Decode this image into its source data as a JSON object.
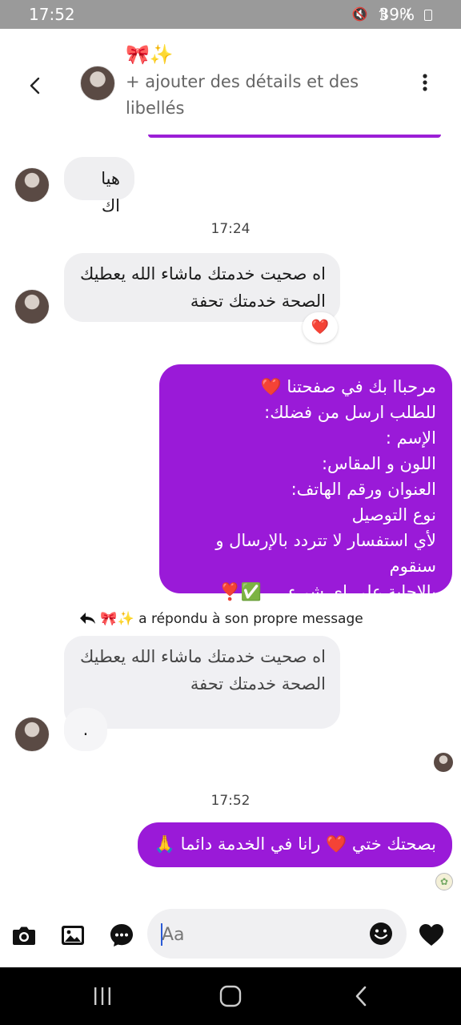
{
  "status_bar": {
    "time": "17:52",
    "battery": "39%"
  },
  "header": {
    "title_emoji": "🎀✨",
    "subtitle": "+ ajouter des détails et des libellés"
  },
  "messages": {
    "m1": "هيا اك",
    "ts1": "17:24",
    "m2": "اه صحيت خدمتك ماشاء الله يعطيك الصحة خدمتك تحفة",
    "m2_reaction": "❤️",
    "m3": [
      "مرحباا بك في صفحتنا ❤️",
      "للطلب ارسل من فضلك:",
      "الإسم :",
      "اللون و المقاس:",
      "العنوان ورقم الهاتف:",
      "نوع التوصيل",
      "لأي استفسار لا تتردد بالإرسال و سنقوم",
      "بالإجابة على اي شيء.... ✅❣️"
    ],
    "reply_note_emoji": "🎀✨",
    "reply_note_text": "a répondu à son propre message",
    "m4_quote": "اه صحيت خدمتك ماشاء الله يعطيك الصحة خدمتك تحفة",
    "m4_reply": ".",
    "ts2": "17:52",
    "m5": "بصحتك ختي ❤️ رانا في الخدمة دائما 🙏"
  },
  "composer": {
    "placeholder": "Aa"
  },
  "icons": {
    "back": "chevron-left-icon",
    "more": "more-vertical-icon",
    "camera": "camera-icon",
    "gallery": "image-icon",
    "chat": "chat-bubble-icon",
    "emoji": "emoji-icon",
    "like": "heart-icon"
  },
  "colors": {
    "accent": "#9a1ad8",
    "incoming": "#efeff1"
  }
}
